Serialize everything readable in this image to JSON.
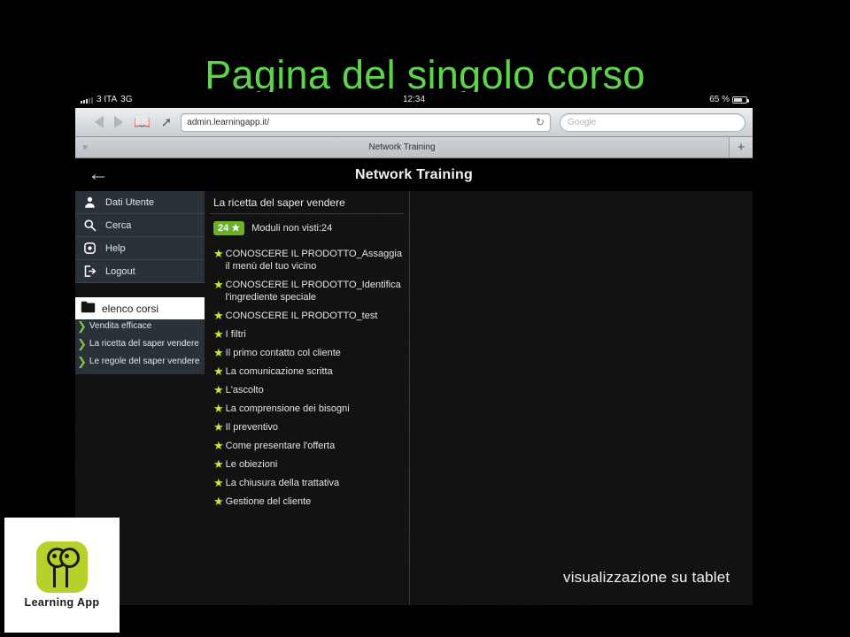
{
  "slide": {
    "title": "Pagina del singolo corso",
    "caption": "visualizzazione su tablet",
    "title_color": "#5ed44a"
  },
  "tablet": {
    "statusbar": {
      "carrier": "3 ITA",
      "network": "3G",
      "time": "12:34",
      "battery": "65 %"
    },
    "browser": {
      "url": "admin.learningapp.it/",
      "search_placeholder": "Google",
      "reload_label": "↻",
      "tab_title": "Network Training",
      "tab_close_label": "×",
      "new_tab_label": "+"
    }
  },
  "app": {
    "header": {
      "title": "Network Training",
      "back_label": "←"
    },
    "sidebar": {
      "menu": [
        {
          "label": "Dati Utente",
          "icon": "user-icon"
        },
        {
          "label": "Cerca",
          "icon": "search-icon"
        },
        {
          "label": "Help",
          "icon": "help-icon"
        },
        {
          "label": "Logout",
          "icon": "logout-icon"
        }
      ],
      "folder_label": "elenco corsi",
      "courses": [
        "Vendita efficace",
        "La ricetta del saper vendere",
        "Le regole del saper vendere"
      ]
    },
    "content": {
      "course_title": "La ricetta del saper vendere",
      "badge_count": "24",
      "badge_star": "★",
      "badge_text": "Moduli non visti:24",
      "modules": [
        "CONOSCERE IL PRODOTTO_Assaggia il menù del tuo vicino",
        "CONOSCERE IL PRODOTTO_Identifica l'ingrediente speciale",
        "CONOSCERE IL PRODOTTO_test",
        "I filtri",
        "Il primo contatto col cliente",
        "La comunicazione scritta",
        "L'ascolto",
        "La comprensione dei bisogni",
        "Il preventivo",
        "Come presentare l'offerta",
        "Le obiezioni",
        "La chiusura della trattativa",
        "Gestione del cliente"
      ],
      "star_glyph": "★",
      "star_color": "#d8e43a"
    }
  },
  "logo": {
    "text": "Learning App",
    "color": "#b5d12c"
  }
}
